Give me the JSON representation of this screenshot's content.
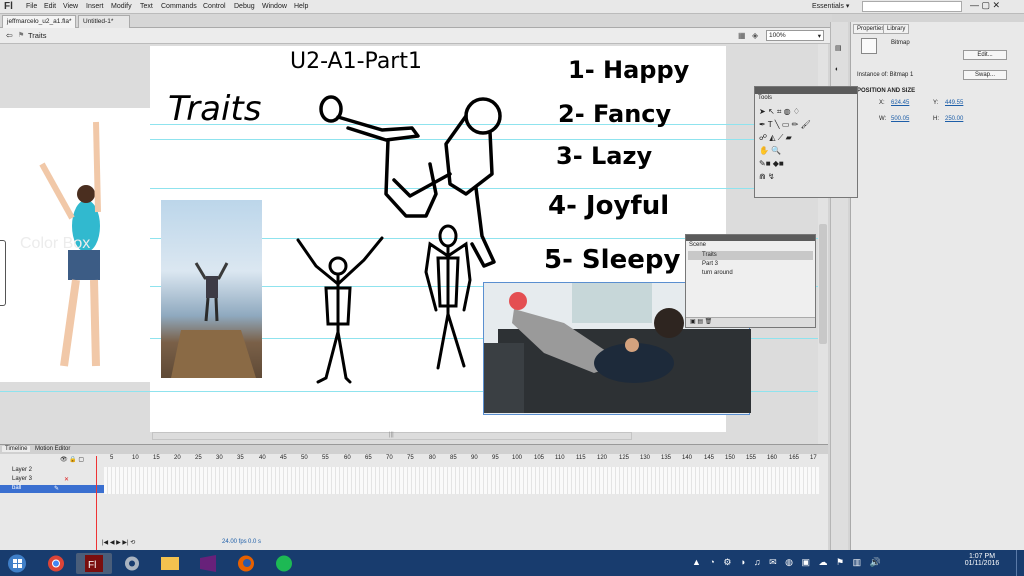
{
  "menu": {
    "logo": "Fl",
    "items": [
      "File",
      "Edit",
      "View",
      "Insert",
      "Modify",
      "Text",
      "Commands",
      "Control",
      "Debug",
      "Window",
      "Help"
    ],
    "workspace": "Essentials ▾"
  },
  "tabs": [
    "jeffmarcelo_u2_a1.fla*",
    "Untitled-1*"
  ],
  "scene_name": "Traits",
  "zoom": "100%",
  "canvas": {
    "header": "U2-A1-Part1",
    "traits_title": "Traits",
    "list": [
      "1- Happy",
      "2- Fancy",
      "3- Lazy",
      "4- Joyful",
      "5- Sleepy"
    ],
    "watermark": "Color Box"
  },
  "timeline": {
    "tabs": [
      "Timeline",
      "Motion Editor"
    ],
    "layers": [
      "Layer 2",
      "Layer 3",
      "ball"
    ],
    "ruler": [
      "5",
      "10",
      "15",
      "20",
      "25",
      "30",
      "35",
      "40",
      "45",
      "50",
      "55",
      "60",
      "65",
      "70",
      "75",
      "80",
      "85",
      "90",
      "95",
      "100",
      "105",
      "110",
      "115",
      "120",
      "125",
      "130",
      "135",
      "140",
      "145",
      "150",
      "155",
      "160",
      "165",
      "17"
    ],
    "status": [
      "24.00 fps",
      "0.0 s"
    ]
  },
  "properties": {
    "tabs": [
      "Properties",
      "Library"
    ],
    "type": "Bitmap",
    "edit": "Edit...",
    "instance_label": "Instance of: Bitmap 1",
    "swap": "Swap...",
    "section": "POSITION AND SIZE",
    "x_label": "X:",
    "x": "624.45",
    "y_label": "Y:",
    "y": "449.55",
    "w_label": "W:",
    "w": "500.05",
    "h_label": "H:",
    "h": "250.00"
  },
  "tools_panel": {
    "title": "Tools"
  },
  "scene_panel": {
    "title": "Scene",
    "items": [
      "Traits",
      "Part 3",
      "turn around"
    ]
  },
  "clock": {
    "time": "1:07 PM",
    "date": "01/11/2016"
  },
  "colors": {
    "taskbar": "#183c6e",
    "guide": "#8fe3ee",
    "playhead": "#e33333"
  }
}
